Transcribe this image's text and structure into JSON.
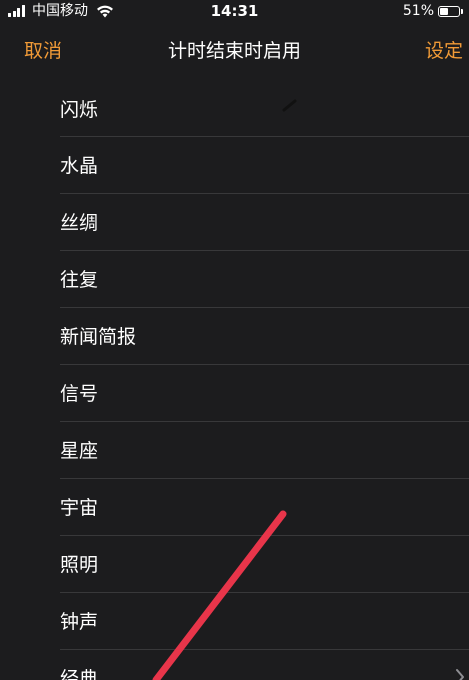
{
  "status_bar": {
    "carrier": "中国移动",
    "time": "14:31",
    "battery_percent": "51%",
    "battery_level": 0.51,
    "icons": [
      "signal-icon",
      "wifi-icon",
      "battery-icon"
    ]
  },
  "nav": {
    "cancel_label": "取消",
    "title": "计时结束时启用",
    "set_label": "设定"
  },
  "list": {
    "items": [
      {
        "label": "闪烁"
      },
      {
        "label": "水晶"
      },
      {
        "label": "丝绸"
      },
      {
        "label": "往复"
      },
      {
        "label": "新闻简报"
      },
      {
        "label": "信号"
      },
      {
        "label": "星座"
      },
      {
        "label": "宇宙"
      },
      {
        "label": "照明"
      },
      {
        "label": "钟声"
      },
      {
        "label": "经典"
      }
    ],
    "chevron_icon": "chevron-right-icon"
  },
  "colors": {
    "background": "#1c1c1e",
    "accent": "#f09a37",
    "separator": "#38383a",
    "annotation": "#e8354a"
  }
}
